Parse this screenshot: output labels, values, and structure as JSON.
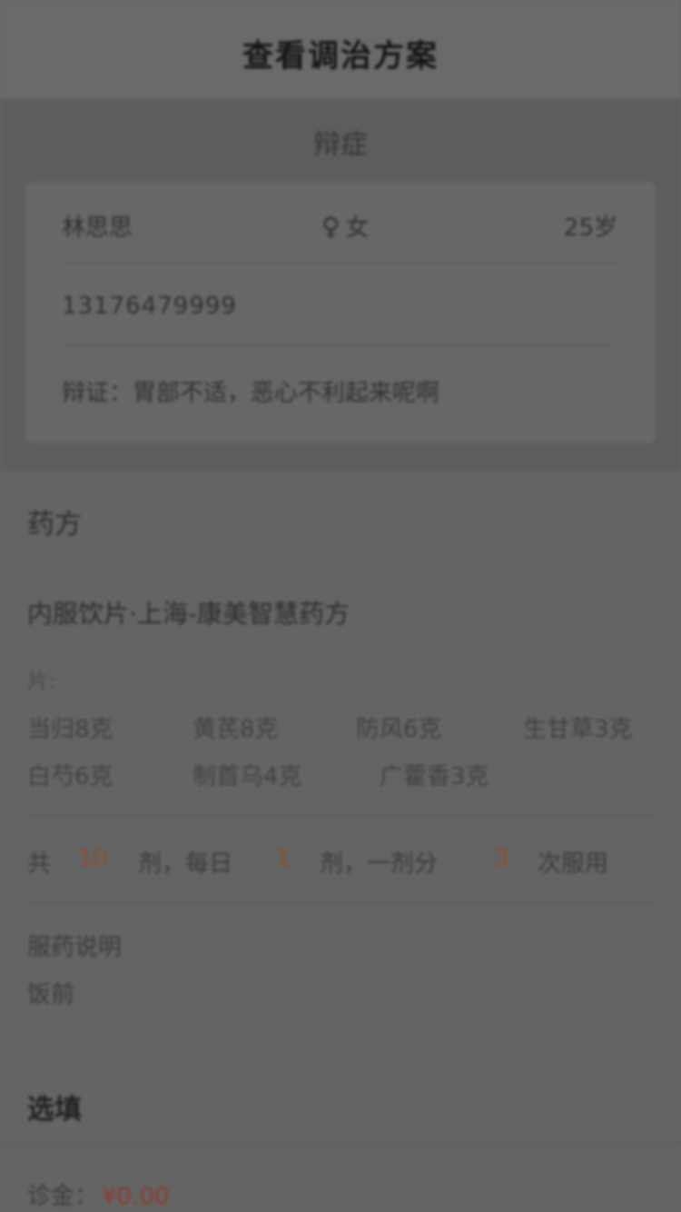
{
  "navbar": {
    "title": "查看调治方案"
  },
  "diagnosis": {
    "section_title": "辩症",
    "patient": {
      "name": "林思思",
      "gender_icon": "female-icon",
      "gender": "女",
      "age": "25岁",
      "phone": "13176479999",
      "syndrome": "辩证：胃部不适，恶心不利起来呢啊"
    }
  },
  "prescription": {
    "section_title": "药方",
    "name": "内服饮片·上海-康美智慧药方",
    "sub_label": "片:",
    "herbs": [
      "当归8克",
      "黄芪8克",
      "防风6克",
      "生甘草3克",
      "白芍6克",
      "制首乌4克",
      "广藿香3克"
    ],
    "dosage": {
      "prefix": "共",
      "total": "10",
      "unit1": "剂，每日",
      "per_day": "1",
      "unit2": "剂，一剂分",
      "times": "3",
      "unit3": "次服用"
    },
    "usage_label": "服药说明",
    "usage_value": "饭前"
  },
  "delivery": {
    "section_title": "选填",
    "fee_label": "诊金：",
    "fee_value": "¥0.00"
  },
  "colors": {
    "overlay": "#646464",
    "accent": "#8c4f2e"
  }
}
